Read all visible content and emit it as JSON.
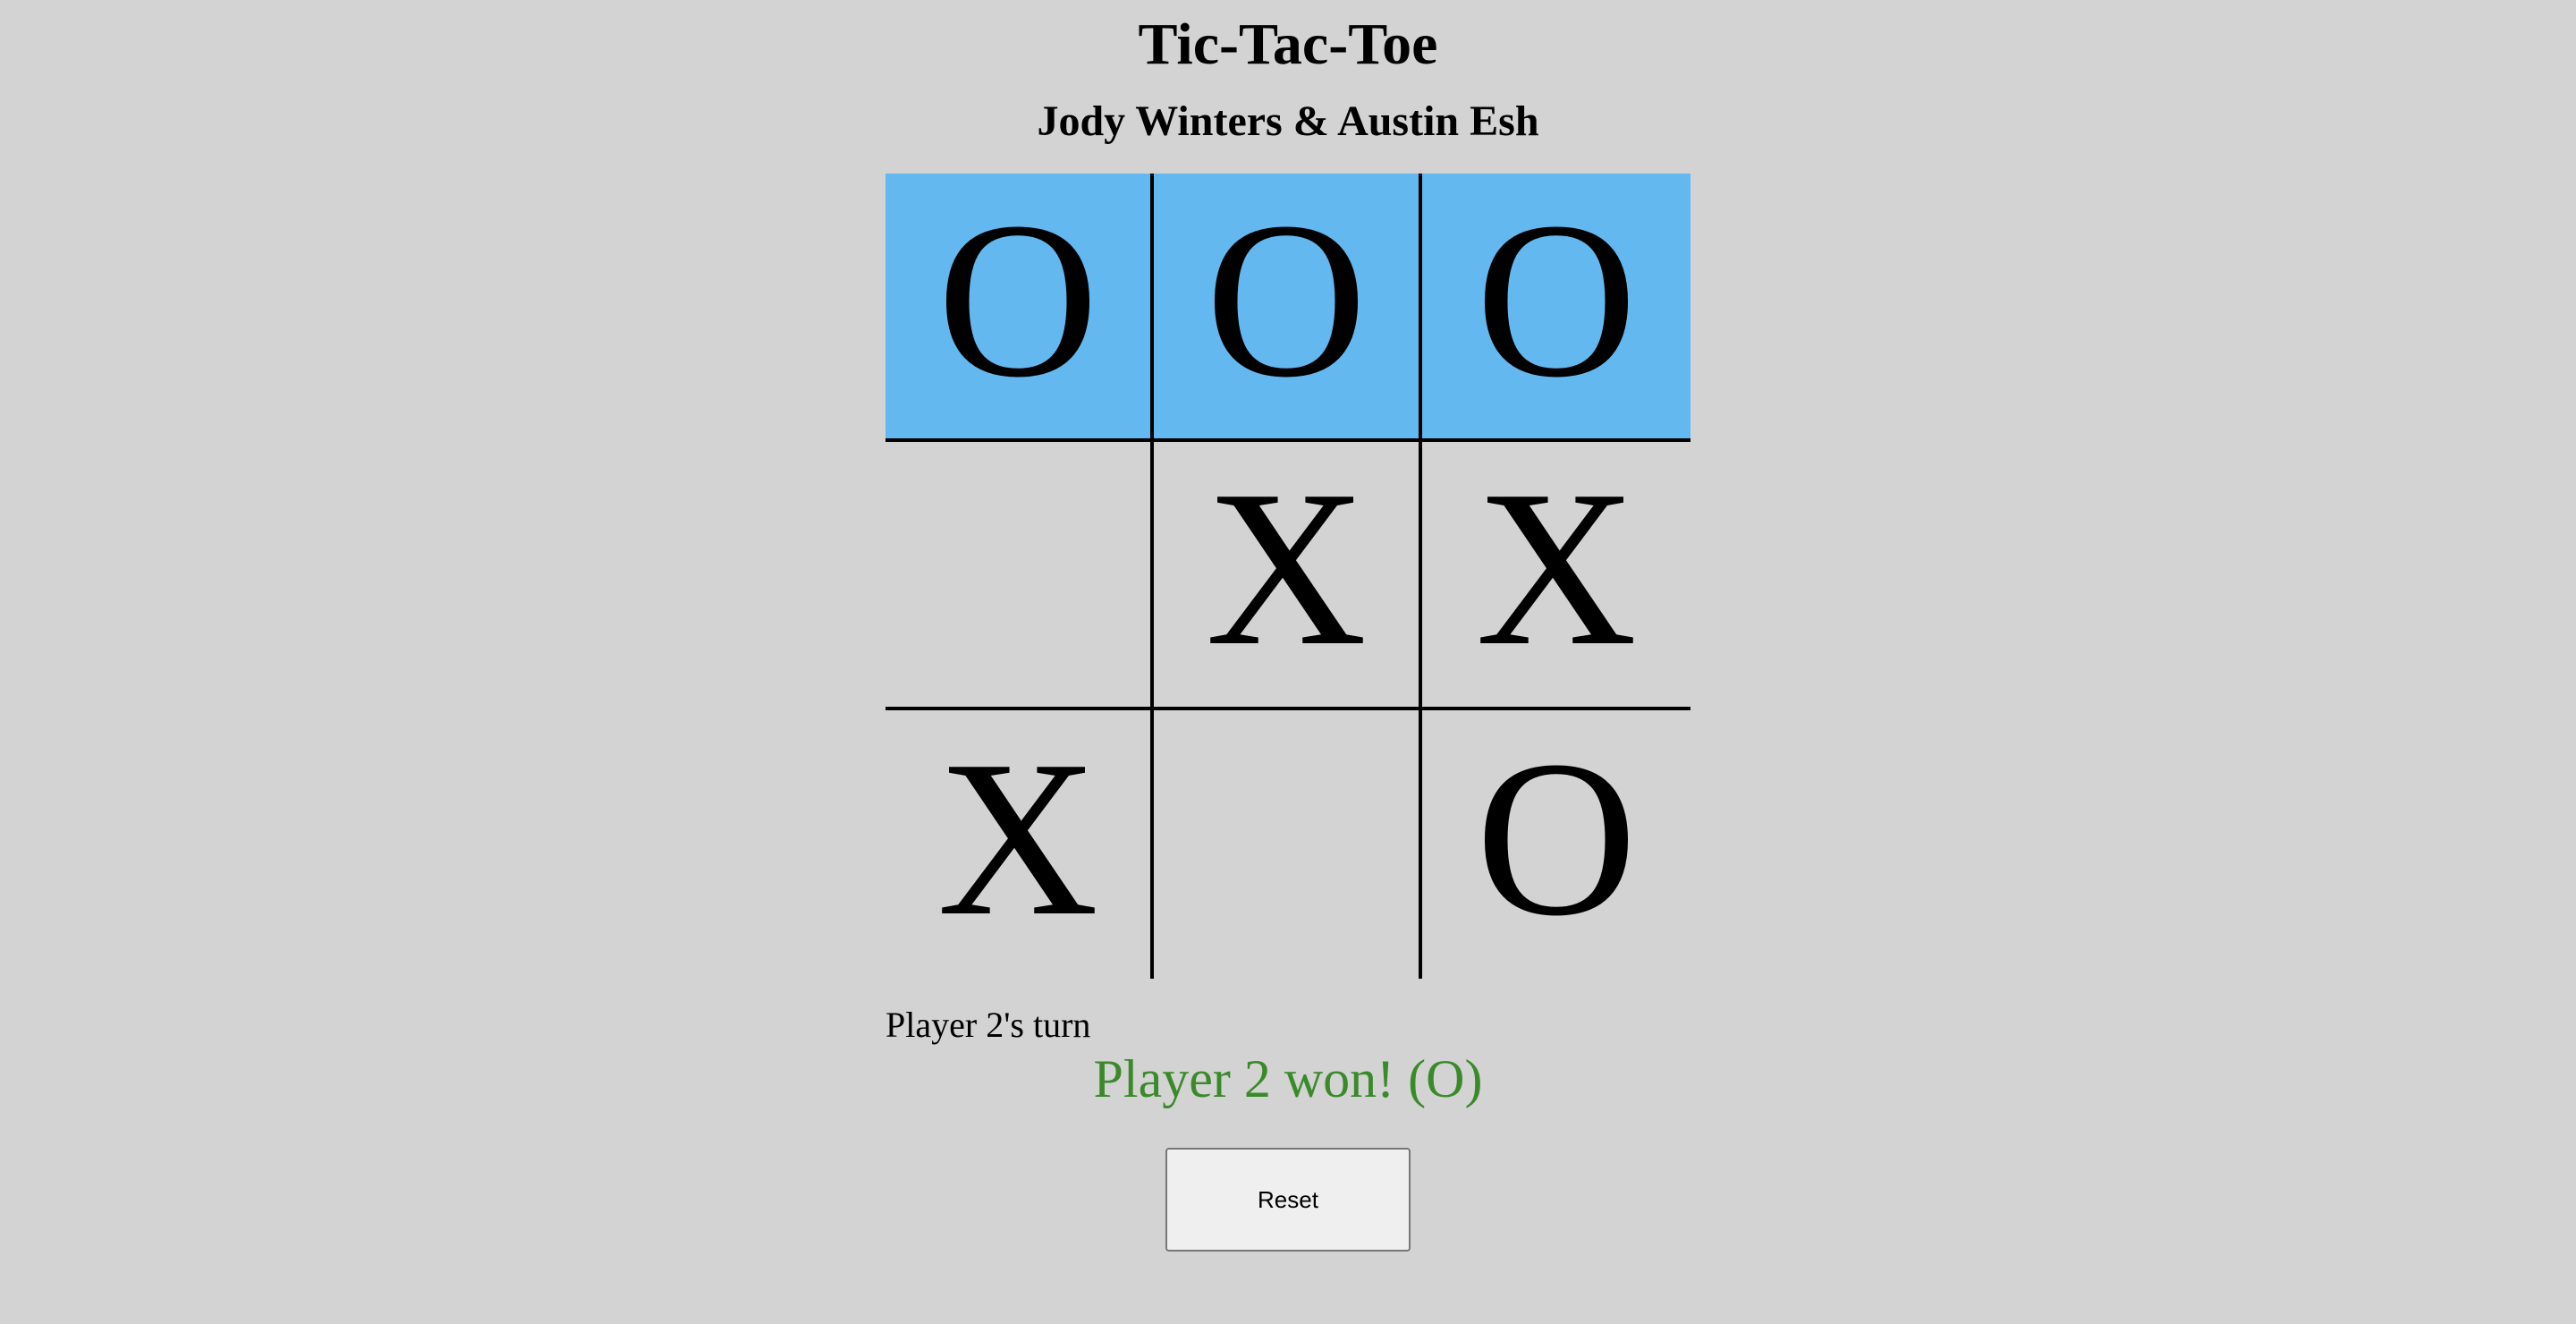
{
  "header": {
    "title": "Tic-Tac-Toe",
    "subtitle": "Jody Winters & Austin Esh"
  },
  "board": {
    "cells": [
      [
        "O",
        "O",
        "O"
      ],
      [
        "",
        "X",
        "X"
      ],
      [
        "X",
        "",
        "O"
      ]
    ],
    "winning_line": [
      [
        0,
        0
      ],
      [
        0,
        1
      ],
      [
        0,
        2
      ]
    ],
    "highlight_color": "#63b8ef"
  },
  "status": {
    "turn_text": "Player 2's turn",
    "result_text": "Player 2 won! (O)",
    "result_color": "#3a8a2a"
  },
  "controls": {
    "reset_label": "Reset"
  }
}
